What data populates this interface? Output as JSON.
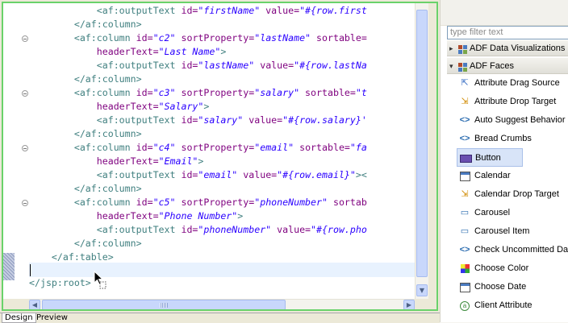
{
  "editor": {
    "code_lines": [
      [
        {
          "t": "            "
        },
        {
          "t": "<af:outputText ",
          "c": "tg"
        },
        {
          "t": "id=",
          "c": "at"
        },
        {
          "t": "\"firstName\"",
          "c": "vl"
        },
        {
          "t": " value=",
          "c": "at"
        },
        {
          "t": "\"#{row.first",
          "c": "vl"
        }
      ],
      [
        {
          "t": "        "
        },
        {
          "t": "</af:column>",
          "c": "tg"
        }
      ],
      [
        {
          "t": "        "
        },
        {
          "t": "<af:column ",
          "c": "tg"
        },
        {
          "t": "id=",
          "c": "at"
        },
        {
          "t": "\"c2\"",
          "c": "vl"
        },
        {
          "t": " sortProperty=",
          "c": "at"
        },
        {
          "t": "\"lastName\"",
          "c": "vl"
        },
        {
          "t": " sortable=",
          "c": "at"
        }
      ],
      [
        {
          "t": "            "
        },
        {
          "t": "headerText=",
          "c": "at"
        },
        {
          "t": "\"Last Name\"",
          "c": "vl"
        },
        {
          "t": ">",
          "c": "tg"
        }
      ],
      [
        {
          "t": "            "
        },
        {
          "t": "<af:outputText ",
          "c": "tg"
        },
        {
          "t": "id=",
          "c": "at"
        },
        {
          "t": "\"lastName\"",
          "c": "vl"
        },
        {
          "t": " value=",
          "c": "at"
        },
        {
          "t": "\"#{row.lastNa",
          "c": "vl"
        }
      ],
      [
        {
          "t": "        "
        },
        {
          "t": "</af:column>",
          "c": "tg"
        }
      ],
      [
        {
          "t": "        "
        },
        {
          "t": "<af:column ",
          "c": "tg"
        },
        {
          "t": "id=",
          "c": "at"
        },
        {
          "t": "\"c3\"",
          "c": "vl"
        },
        {
          "t": " sortProperty=",
          "c": "at"
        },
        {
          "t": "\"salary\"",
          "c": "vl"
        },
        {
          "t": " sortable=",
          "c": "at"
        },
        {
          "t": "\"t",
          "c": "vl"
        }
      ],
      [
        {
          "t": "            "
        },
        {
          "t": "headerText=",
          "c": "at"
        },
        {
          "t": "\"Salary\"",
          "c": "vl"
        },
        {
          "t": ">",
          "c": "tg"
        }
      ],
      [
        {
          "t": "            "
        },
        {
          "t": "<af:outputText ",
          "c": "tg"
        },
        {
          "t": "id=",
          "c": "at"
        },
        {
          "t": "\"salary\"",
          "c": "vl"
        },
        {
          "t": " value=",
          "c": "at"
        },
        {
          "t": "\"#{row.salary}'",
          "c": "vl"
        }
      ],
      [
        {
          "t": "        "
        },
        {
          "t": "</af:column>",
          "c": "tg"
        }
      ],
      [
        {
          "t": "        "
        },
        {
          "t": "<af:column ",
          "c": "tg"
        },
        {
          "t": "id=",
          "c": "at"
        },
        {
          "t": "\"c4\"",
          "c": "vl"
        },
        {
          "t": " sortProperty=",
          "c": "at"
        },
        {
          "t": "\"email\"",
          "c": "vl"
        },
        {
          "t": " sortable=",
          "c": "at"
        },
        {
          "t": "\"fa",
          "c": "vl"
        }
      ],
      [
        {
          "t": "            "
        },
        {
          "t": "headerText=",
          "c": "at"
        },
        {
          "t": "\"Email\"",
          "c": "vl"
        },
        {
          "t": ">",
          "c": "tg"
        }
      ],
      [
        {
          "t": "            "
        },
        {
          "t": "<af:outputText ",
          "c": "tg"
        },
        {
          "t": "id=",
          "c": "at"
        },
        {
          "t": "\"email\"",
          "c": "vl"
        },
        {
          "t": " value=",
          "c": "at"
        },
        {
          "t": "\"#{row.email}\"",
          "c": "vl"
        },
        {
          "t": "><",
          "c": "tg"
        }
      ],
      [
        {
          "t": "        "
        },
        {
          "t": "</af:column>",
          "c": "tg"
        }
      ],
      [
        {
          "t": "        "
        },
        {
          "t": "<af:column ",
          "c": "tg"
        },
        {
          "t": "id=",
          "c": "at"
        },
        {
          "t": "\"c5\"",
          "c": "vl"
        },
        {
          "t": " sortProperty=",
          "c": "at"
        },
        {
          "t": "\"phoneNumber\"",
          "c": "vl"
        },
        {
          "t": " sortab",
          "c": "at"
        }
      ],
      [
        {
          "t": "            "
        },
        {
          "t": "headerText=",
          "c": "at"
        },
        {
          "t": "\"Phone Number\"",
          "c": "vl"
        },
        {
          "t": ">",
          "c": "tg"
        }
      ],
      [
        {
          "t": "            "
        },
        {
          "t": "<af:outputText ",
          "c": "tg"
        },
        {
          "t": "id=",
          "c": "at"
        },
        {
          "t": "\"phoneNumber\"",
          "c": "vl"
        },
        {
          "t": " value=",
          "c": "at"
        },
        {
          "t": "\"#{row.pho",
          "c": "vl"
        }
      ],
      [
        {
          "t": "        "
        },
        {
          "t": "</af:column>",
          "c": "tg"
        }
      ],
      [
        {
          "t": "    "
        },
        {
          "t": "</af:table>",
          "c": "tg"
        }
      ],
      [
        {
          "t": ""
        }
      ],
      [
        {
          "t": "</jsp:root>",
          "c": "tg"
        }
      ]
    ],
    "fold_rows": [
      2,
      6,
      10,
      14
    ]
  },
  "tabs": {
    "design": "Design",
    "preview": "Preview"
  },
  "palette": {
    "filter_placeholder": "type filter text",
    "categories": [
      {
        "label": "ADF Data Visualizations",
        "expanded": false,
        "icon": "adf-dv-icon"
      },
      {
        "label": "ADF Faces",
        "expanded": true,
        "icon": "adf-faces-icon"
      }
    ],
    "items": [
      {
        "label": "Attribute Drag Source",
        "icon": "drag-source-icon"
      },
      {
        "label": "Attribute Drop Target",
        "icon": "drop-target-icon"
      },
      {
        "label": "Auto Suggest Behavior",
        "icon": "auto-suggest-icon"
      },
      {
        "label": "Bread Crumbs",
        "icon": "bread-crumbs-icon"
      },
      {
        "label": "Button",
        "icon": "button-icon",
        "selected": true
      },
      {
        "label": "Calendar",
        "icon": "calendar-icon"
      },
      {
        "label": "Calendar Drop Target",
        "icon": "calendar-drop-icon"
      },
      {
        "label": "Carousel",
        "icon": "carousel-icon"
      },
      {
        "label": "Carousel Item",
        "icon": "carousel-item-icon"
      },
      {
        "label": "Check Uncommitted Data",
        "icon": "check-uncommitted-icon"
      },
      {
        "label": "Choose Color",
        "icon": "choose-color-icon"
      },
      {
        "label": "Choose Date",
        "icon": "choose-date-icon"
      },
      {
        "label": "Client Attribute",
        "icon": "client-attribute-icon"
      }
    ]
  }
}
